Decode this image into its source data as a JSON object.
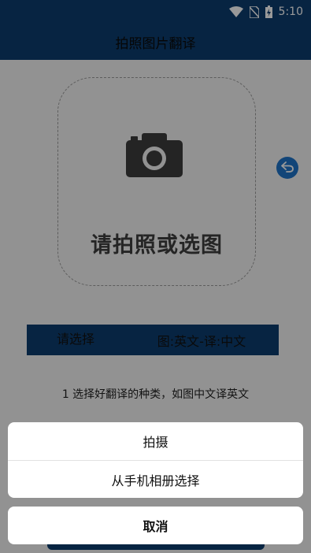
{
  "status_bar": {
    "time": "5:10",
    "icons": [
      "wifi-icon",
      "no-sim-icon",
      "battery-charging-icon"
    ]
  },
  "header": {
    "title": "拍照图片翻译"
  },
  "picker": {
    "label": "请拍照或选图",
    "icon": "camera-icon"
  },
  "back_button": {
    "icon": "back-arrow-icon"
  },
  "segment": {
    "left_label": "请选择",
    "right_label": "图:英文-译:中文"
  },
  "instruction": "1 选择好翻译的种类，如图中文译英文",
  "action_sheet": {
    "items": [
      "拍摄",
      "从手机相册选择"
    ],
    "cancel": "取消"
  },
  "colors": {
    "primary": "#0d3c6e",
    "accent": "#1e73c8",
    "background": "#f4f4f4"
  }
}
